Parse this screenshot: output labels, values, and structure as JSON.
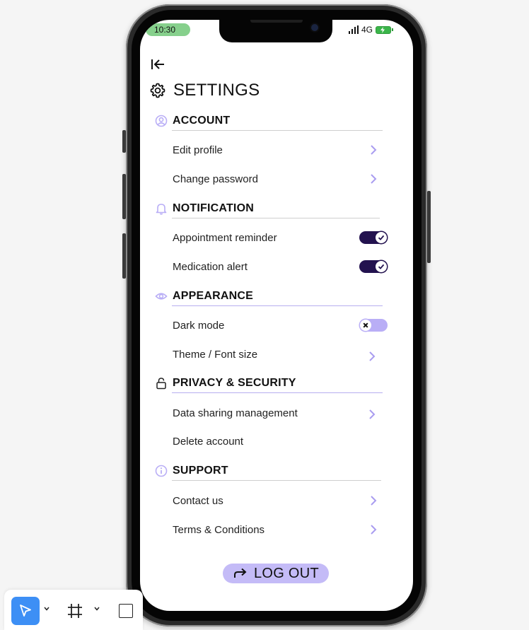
{
  "status_bar": {
    "time": "10:30",
    "network": "4G"
  },
  "page_title": "SETTINGS",
  "sections": {
    "account": {
      "title": "ACCOUNT",
      "items": [
        {
          "label": "Edit profile"
        },
        {
          "label": "Change password"
        }
      ]
    },
    "notification": {
      "title": "NOTIFICATION",
      "items": [
        {
          "label": "Appointment reminder",
          "toggle": "on"
        },
        {
          "label": "Medication alert",
          "toggle": "on"
        }
      ]
    },
    "appearance": {
      "title": "APPEARANCE",
      "items": [
        {
          "label": "Dark mode",
          "toggle": "off"
        },
        {
          "label": "Theme / Font size"
        }
      ]
    },
    "privacy": {
      "title": "PRIVACY & SECURITY",
      "items": [
        {
          "label": "Data sharing management"
        },
        {
          "label": "Delete account"
        }
      ]
    },
    "support": {
      "title": "SUPPORT",
      "items": [
        {
          "label": "Contact us"
        },
        {
          "label": "Terms & Conditions"
        }
      ]
    }
  },
  "logout_label": "LOG OUT",
  "icons": {
    "back": "back-arrow-icon",
    "settings": "gear-icon",
    "account": "user-circle-icon",
    "notification": "bell-icon",
    "appearance": "eye-icon",
    "privacy": "lock-icon",
    "support": "info-icon",
    "chevron": "chevron-right-icon",
    "logout": "redo-arrow-icon",
    "tool_select": "pointer-icon",
    "tool_frame": "frame-icon",
    "tool_rect": "rectangle-icon"
  },
  "colors": {
    "accent": "#b9aef6",
    "toggle_on": "#23124f",
    "logout_bg": "#c4bbf7",
    "battery": "#3bb54a",
    "time_pill": "#86d08c",
    "tool_active": "#3d8ff5"
  }
}
